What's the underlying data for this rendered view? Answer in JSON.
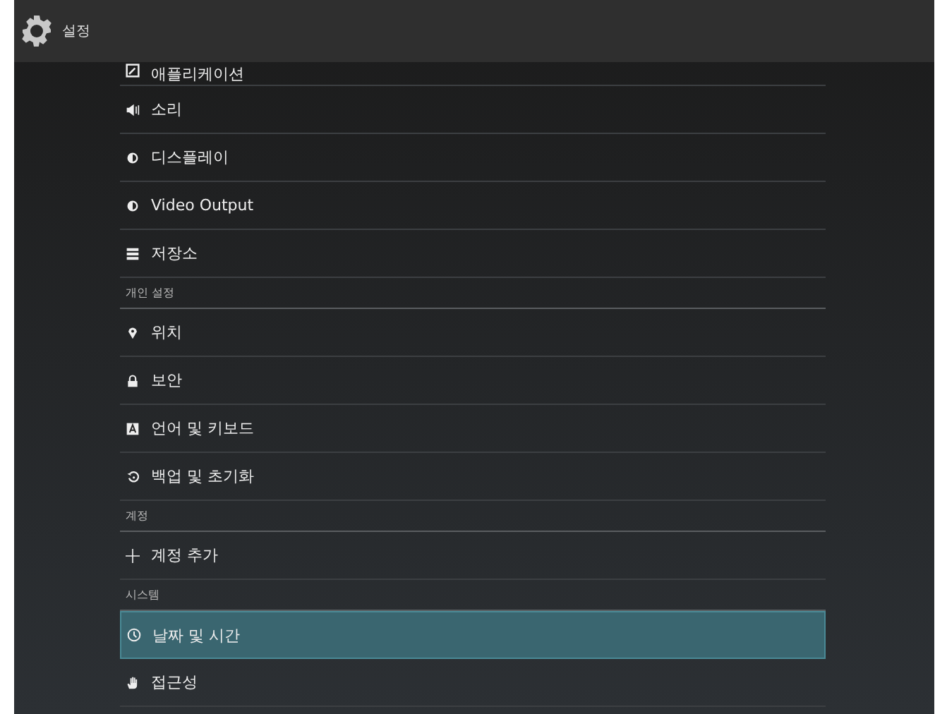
{
  "window": {
    "title": "설정"
  },
  "items": [
    {
      "kind": "item",
      "label": "애플리케이션",
      "selected": false
    },
    {
      "kind": "item",
      "label": "소리",
      "selected": false
    },
    {
      "kind": "item",
      "label": "디스플레이",
      "selected": false
    },
    {
      "kind": "item",
      "label": "Video Output",
      "selected": false
    },
    {
      "kind": "item",
      "label": "저장소",
      "selected": false
    },
    {
      "kind": "header",
      "label": "개인 설정"
    },
    {
      "kind": "item",
      "label": "위치",
      "selected": false
    },
    {
      "kind": "item",
      "label": "보안",
      "selected": false
    },
    {
      "kind": "item",
      "label": "언어 및 키보드",
      "selected": false
    },
    {
      "kind": "item",
      "label": "백업 및 초기화",
      "selected": false
    },
    {
      "kind": "header",
      "label": "계정"
    },
    {
      "kind": "item",
      "label": "계정 추가",
      "selected": false
    },
    {
      "kind": "header",
      "label": "시스템"
    },
    {
      "kind": "item",
      "label": "날짜 및 시간",
      "selected": true
    },
    {
      "kind": "item",
      "label": "접근성",
      "selected": false
    }
  ]
}
